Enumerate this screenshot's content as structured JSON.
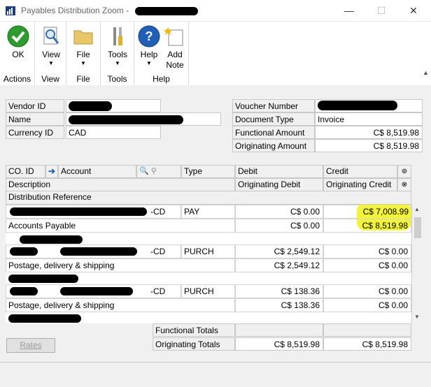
{
  "window": {
    "title": "Payables Distribution Zoom -",
    "minimize_icon": "minimize-icon",
    "maximize_icon": "maximize-icon",
    "close_icon": "close-icon"
  },
  "ribbon": {
    "groups": [
      {
        "label": "Actions",
        "button": {
          "label": "OK",
          "icon": "check-icon"
        }
      },
      {
        "label": "View",
        "button": {
          "label": "View",
          "icon": "magnifier-document-icon"
        }
      },
      {
        "label": "File",
        "button": {
          "label": "File",
          "icon": "folder-icon"
        }
      },
      {
        "label": "Tools",
        "button": {
          "label": "Tools",
          "icon": "tools-icon"
        }
      },
      {
        "label": "Help",
        "buttons": [
          {
            "label": "Help",
            "icon": "help-icon"
          },
          {
            "label": "Add",
            "label2": "Note",
            "icon": "note-icon"
          }
        ]
      }
    ]
  },
  "header": {
    "vendor_id_label": "Vendor ID",
    "name_label": "Name",
    "currency_id_label": "Currency ID",
    "currency_id_value": "CAD",
    "voucher_number_label": "Voucher Number",
    "document_type_label": "Document Type",
    "document_type_value": "Invoice",
    "functional_amount_label": "Functional Amount",
    "functional_amount_value": "C$ 8,519.98",
    "originating_amount_label": "Originating Amount",
    "originating_amount_value": "C$ 8,519.98"
  },
  "grid": {
    "headers": {
      "co_id": "CO. ID",
      "account": "Account",
      "type": "Type",
      "debit": "Debit",
      "credit": "Credit",
      "description": "Description",
      "originating_debit": "Originating Debit",
      "originating_credit": "Originating Credit",
      "distribution_reference": "Distribution Reference"
    },
    "rows": [
      {
        "account_suffix": "-CD",
        "type": "PAY",
        "debit": "C$ 0.00",
        "credit": "C$ 7,008.99",
        "description": "Accounts Payable",
        "orig_debit": "C$ 0.00",
        "orig_credit": "C$ 8,519.98"
      },
      {
        "account_suffix": "-CD",
        "type": "PURCH",
        "debit": "C$ 2,549.12",
        "credit": "C$ 0.00",
        "description": "Postage, delivery & shipping",
        "orig_debit": "C$ 2,549.12",
        "orig_credit": "C$ 0.00"
      },
      {
        "account_suffix": "-CD",
        "type": "PURCH",
        "debit": "C$ 138.36",
        "credit": "C$ 0.00",
        "description": "Postage, delivery & shipping",
        "orig_debit": "C$ 138.36",
        "orig_credit": "C$ 0.00"
      }
    ]
  },
  "totals": {
    "functional_label": "Functional Totals",
    "originating_label": "Originating Totals",
    "originating_debit": "C$ 8,519.98",
    "originating_credit": "C$ 8,519.98"
  },
  "footer": {
    "rates_button": "Rates"
  },
  "colors": {
    "highlight": "#f3f33a",
    "ok_green": "#2e9b2e",
    "help_blue": "#1f5fb4"
  }
}
